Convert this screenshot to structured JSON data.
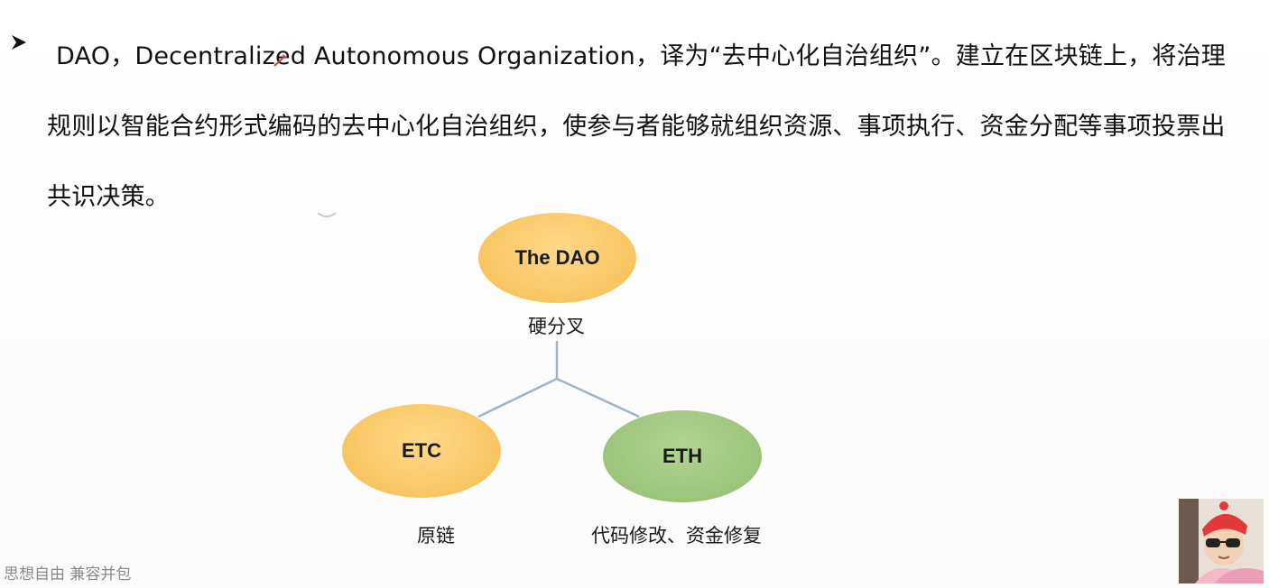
{
  "content": {
    "bullet_icon": "arrow-bullet-icon",
    "paragraph": "DAO，Decentralized Autonomous Organization，译为“去中心化自治组织”。建立在区块链上，将治理规则以智能合约形式编码的去中心化自治组织，使参与者能够就组织资源、事项执行、资金分配等事项投票出共识决策。"
  },
  "diagram": {
    "root": {
      "label": "The DAO",
      "color": "#f8c560"
    },
    "edge_label": "硬分叉",
    "left": {
      "label": "ETC",
      "caption": "原链",
      "color": "#f8c560"
    },
    "right": {
      "label": "ETH",
      "caption": "代码修改、资金修复",
      "color": "#9cc47b"
    },
    "connector_color": "#9fb4c8"
  },
  "watermark": "思想自由 兼容并包",
  "presenter": {
    "icon": "presenter-avatar"
  }
}
